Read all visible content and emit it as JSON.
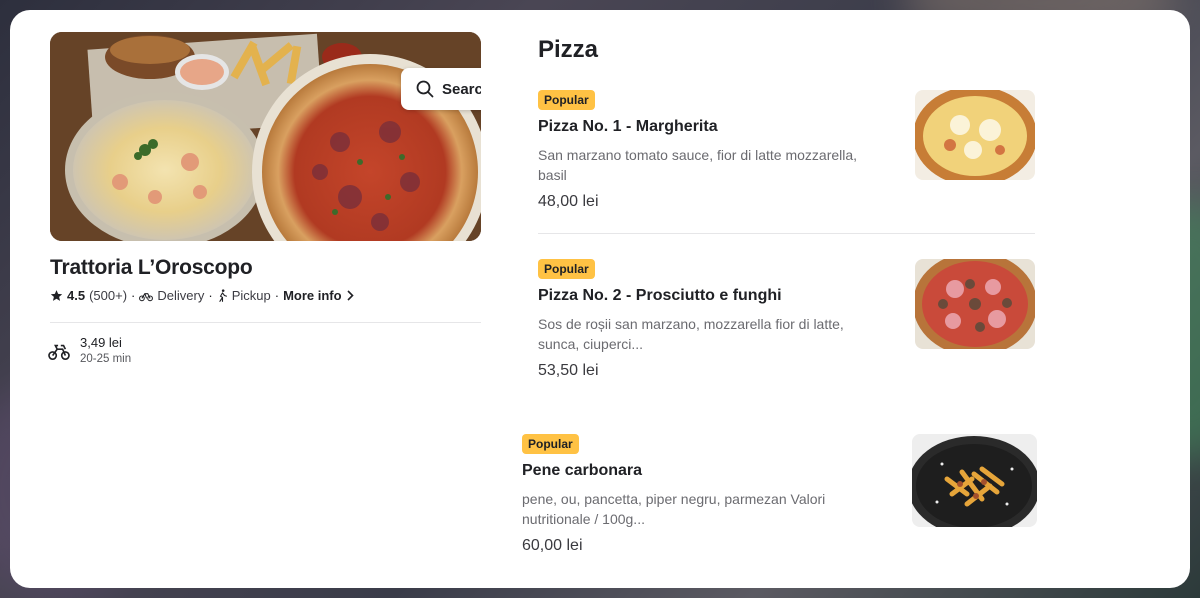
{
  "search": {
    "label": "Search"
  },
  "restaurant": {
    "name": "Trattoria L’Oroscopo",
    "rating": "4.5",
    "reviews": "(500+)",
    "delivery": "Delivery",
    "pickup": "Pickup",
    "more_info": "More info",
    "separator": "·",
    "delivery_fee": "3,49 lei",
    "delivery_time": "20-25 min"
  },
  "menu": {
    "section_title": "Pizza",
    "items": [
      {
        "badge": "Popular",
        "name": "Pizza No. 1 - Margherita",
        "desc": "San marzano tomato sauce, fior di latte mozzarella, basil",
        "price": "48,00 lei"
      },
      {
        "badge": "Popular",
        "name": "Pizza No. 2 -  Prosciutto e funghi",
        "desc": "Sos de roșii san marzano, mozzarella fior di latte, sunca, ciuperci...",
        "price": "53,50 lei"
      },
      {
        "badge": "Popular",
        "name": "Pene carbonara",
        "desc": "pene, ou, pancetta, piper negru, parmezan Valori nutritionale / 100g...",
        "price": "60,00 lei"
      }
    ]
  },
  "icons": {
    "star": "star-icon",
    "delivery": "bicycle-icon",
    "pickup": "walking-icon",
    "more": "chevron-right-icon",
    "search": "search-icon",
    "courier": "courier-bike-icon"
  },
  "colors": {
    "badge": "#ffc244",
    "text": "#202125",
    "muted": "#6b6b70",
    "card": "#ffffff"
  }
}
